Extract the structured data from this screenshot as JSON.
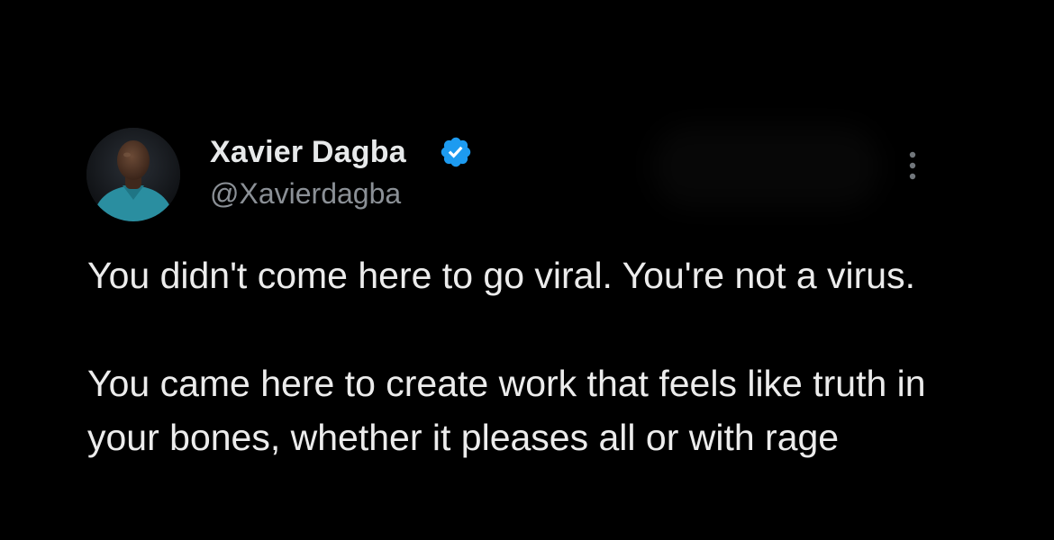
{
  "author": {
    "name": "Xavier Dagba",
    "handle": "@Xavierdagba",
    "verified": true,
    "verified_color": "#1d9bf0"
  },
  "menu": {
    "more_icon": "more-vertical-icon"
  },
  "tweet": {
    "paragraphs": [
      "You didn't come here to go viral. You're not a virus.",
      "You came here to create work that feels like truth in your bones, whether it pleases all or with rage"
    ]
  },
  "colors": {
    "background": "#000000",
    "text": "#e7e9ea",
    "secondary_text": "#8b9096"
  }
}
